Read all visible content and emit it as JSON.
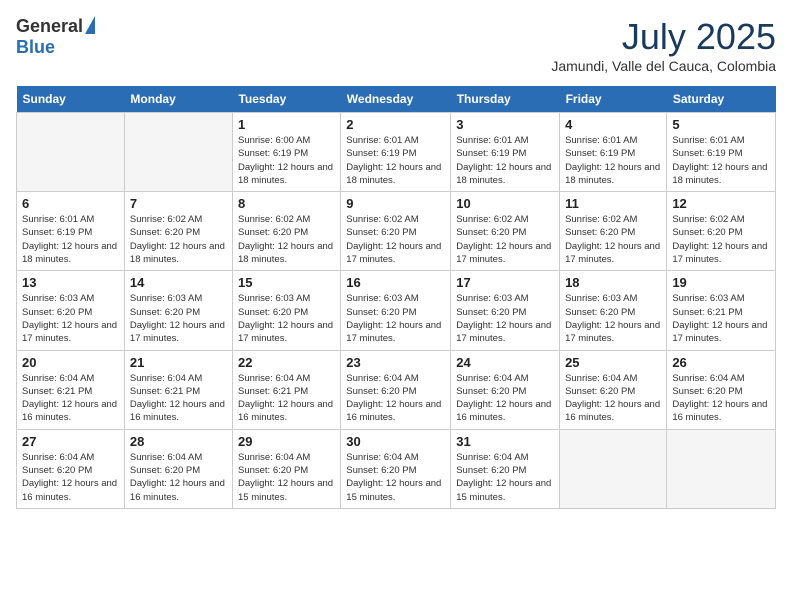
{
  "header": {
    "logo_general": "General",
    "logo_blue": "Blue",
    "month_title": "July 2025",
    "location": "Jamundi, Valle del Cauca, Colombia"
  },
  "days_of_week": [
    "Sunday",
    "Monday",
    "Tuesday",
    "Wednesday",
    "Thursday",
    "Friday",
    "Saturday"
  ],
  "weeks": [
    [
      {
        "day": "",
        "info": ""
      },
      {
        "day": "",
        "info": ""
      },
      {
        "day": "1",
        "info": "Sunrise: 6:00 AM\nSunset: 6:19 PM\nDaylight: 12 hours and 18 minutes."
      },
      {
        "day": "2",
        "info": "Sunrise: 6:01 AM\nSunset: 6:19 PM\nDaylight: 12 hours and 18 minutes."
      },
      {
        "day": "3",
        "info": "Sunrise: 6:01 AM\nSunset: 6:19 PM\nDaylight: 12 hours and 18 minutes."
      },
      {
        "day": "4",
        "info": "Sunrise: 6:01 AM\nSunset: 6:19 PM\nDaylight: 12 hours and 18 minutes."
      },
      {
        "day": "5",
        "info": "Sunrise: 6:01 AM\nSunset: 6:19 PM\nDaylight: 12 hours and 18 minutes."
      }
    ],
    [
      {
        "day": "6",
        "info": "Sunrise: 6:01 AM\nSunset: 6:19 PM\nDaylight: 12 hours and 18 minutes."
      },
      {
        "day": "7",
        "info": "Sunrise: 6:02 AM\nSunset: 6:20 PM\nDaylight: 12 hours and 18 minutes."
      },
      {
        "day": "8",
        "info": "Sunrise: 6:02 AM\nSunset: 6:20 PM\nDaylight: 12 hours and 18 minutes."
      },
      {
        "day": "9",
        "info": "Sunrise: 6:02 AM\nSunset: 6:20 PM\nDaylight: 12 hours and 17 minutes."
      },
      {
        "day": "10",
        "info": "Sunrise: 6:02 AM\nSunset: 6:20 PM\nDaylight: 12 hours and 17 minutes."
      },
      {
        "day": "11",
        "info": "Sunrise: 6:02 AM\nSunset: 6:20 PM\nDaylight: 12 hours and 17 minutes."
      },
      {
        "day": "12",
        "info": "Sunrise: 6:02 AM\nSunset: 6:20 PM\nDaylight: 12 hours and 17 minutes."
      }
    ],
    [
      {
        "day": "13",
        "info": "Sunrise: 6:03 AM\nSunset: 6:20 PM\nDaylight: 12 hours and 17 minutes."
      },
      {
        "day": "14",
        "info": "Sunrise: 6:03 AM\nSunset: 6:20 PM\nDaylight: 12 hours and 17 minutes."
      },
      {
        "day": "15",
        "info": "Sunrise: 6:03 AM\nSunset: 6:20 PM\nDaylight: 12 hours and 17 minutes."
      },
      {
        "day": "16",
        "info": "Sunrise: 6:03 AM\nSunset: 6:20 PM\nDaylight: 12 hours and 17 minutes."
      },
      {
        "day": "17",
        "info": "Sunrise: 6:03 AM\nSunset: 6:20 PM\nDaylight: 12 hours and 17 minutes."
      },
      {
        "day": "18",
        "info": "Sunrise: 6:03 AM\nSunset: 6:20 PM\nDaylight: 12 hours and 17 minutes."
      },
      {
        "day": "19",
        "info": "Sunrise: 6:03 AM\nSunset: 6:21 PM\nDaylight: 12 hours and 17 minutes."
      }
    ],
    [
      {
        "day": "20",
        "info": "Sunrise: 6:04 AM\nSunset: 6:21 PM\nDaylight: 12 hours and 16 minutes."
      },
      {
        "day": "21",
        "info": "Sunrise: 6:04 AM\nSunset: 6:21 PM\nDaylight: 12 hours and 16 minutes."
      },
      {
        "day": "22",
        "info": "Sunrise: 6:04 AM\nSunset: 6:21 PM\nDaylight: 12 hours and 16 minutes."
      },
      {
        "day": "23",
        "info": "Sunrise: 6:04 AM\nSunset: 6:20 PM\nDaylight: 12 hours and 16 minutes."
      },
      {
        "day": "24",
        "info": "Sunrise: 6:04 AM\nSunset: 6:20 PM\nDaylight: 12 hours and 16 minutes."
      },
      {
        "day": "25",
        "info": "Sunrise: 6:04 AM\nSunset: 6:20 PM\nDaylight: 12 hours and 16 minutes."
      },
      {
        "day": "26",
        "info": "Sunrise: 6:04 AM\nSunset: 6:20 PM\nDaylight: 12 hours and 16 minutes."
      }
    ],
    [
      {
        "day": "27",
        "info": "Sunrise: 6:04 AM\nSunset: 6:20 PM\nDaylight: 12 hours and 16 minutes."
      },
      {
        "day": "28",
        "info": "Sunrise: 6:04 AM\nSunset: 6:20 PM\nDaylight: 12 hours and 16 minutes."
      },
      {
        "day": "29",
        "info": "Sunrise: 6:04 AM\nSunset: 6:20 PM\nDaylight: 12 hours and 15 minutes."
      },
      {
        "day": "30",
        "info": "Sunrise: 6:04 AM\nSunset: 6:20 PM\nDaylight: 12 hours and 15 minutes."
      },
      {
        "day": "31",
        "info": "Sunrise: 6:04 AM\nSunset: 6:20 PM\nDaylight: 12 hours and 15 minutes."
      },
      {
        "day": "",
        "info": ""
      },
      {
        "day": "",
        "info": ""
      }
    ]
  ]
}
